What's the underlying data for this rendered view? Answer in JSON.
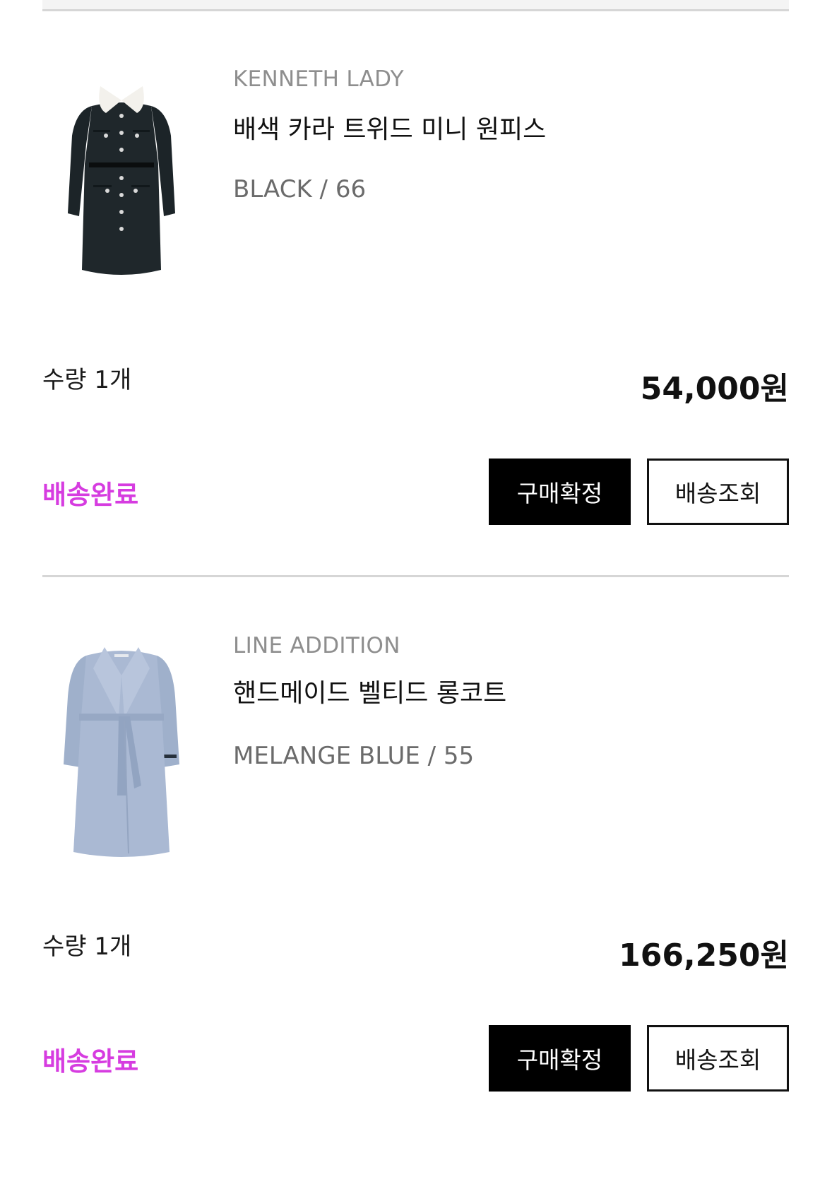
{
  "colors": {
    "status": "#d63ce0",
    "divider": "#d6d6d6",
    "primary_button_bg": "#000000",
    "outline_button_border": "#111111"
  },
  "orders": [
    {
      "brand": "KENNETH LADY",
      "product_name": "배색 카라 트위드 미니 원피스",
      "option": "BLACK / 66",
      "quantity": "수량 1개",
      "price": "54,000원",
      "status": "배송완료",
      "confirm_button": "구매확정",
      "track_button": "배송조회",
      "image_icon": "tweed-dress-image"
    },
    {
      "brand": "LINE ADDITION",
      "product_name": "핸드메이드 벨티드 롱코트",
      "option": "MELANGE BLUE / 55",
      "quantity": "수량 1개",
      "price": "166,250원",
      "status": "배송완료",
      "confirm_button": "구매확정",
      "track_button": "배송조회",
      "image_icon": "belted-coat-image"
    }
  ]
}
